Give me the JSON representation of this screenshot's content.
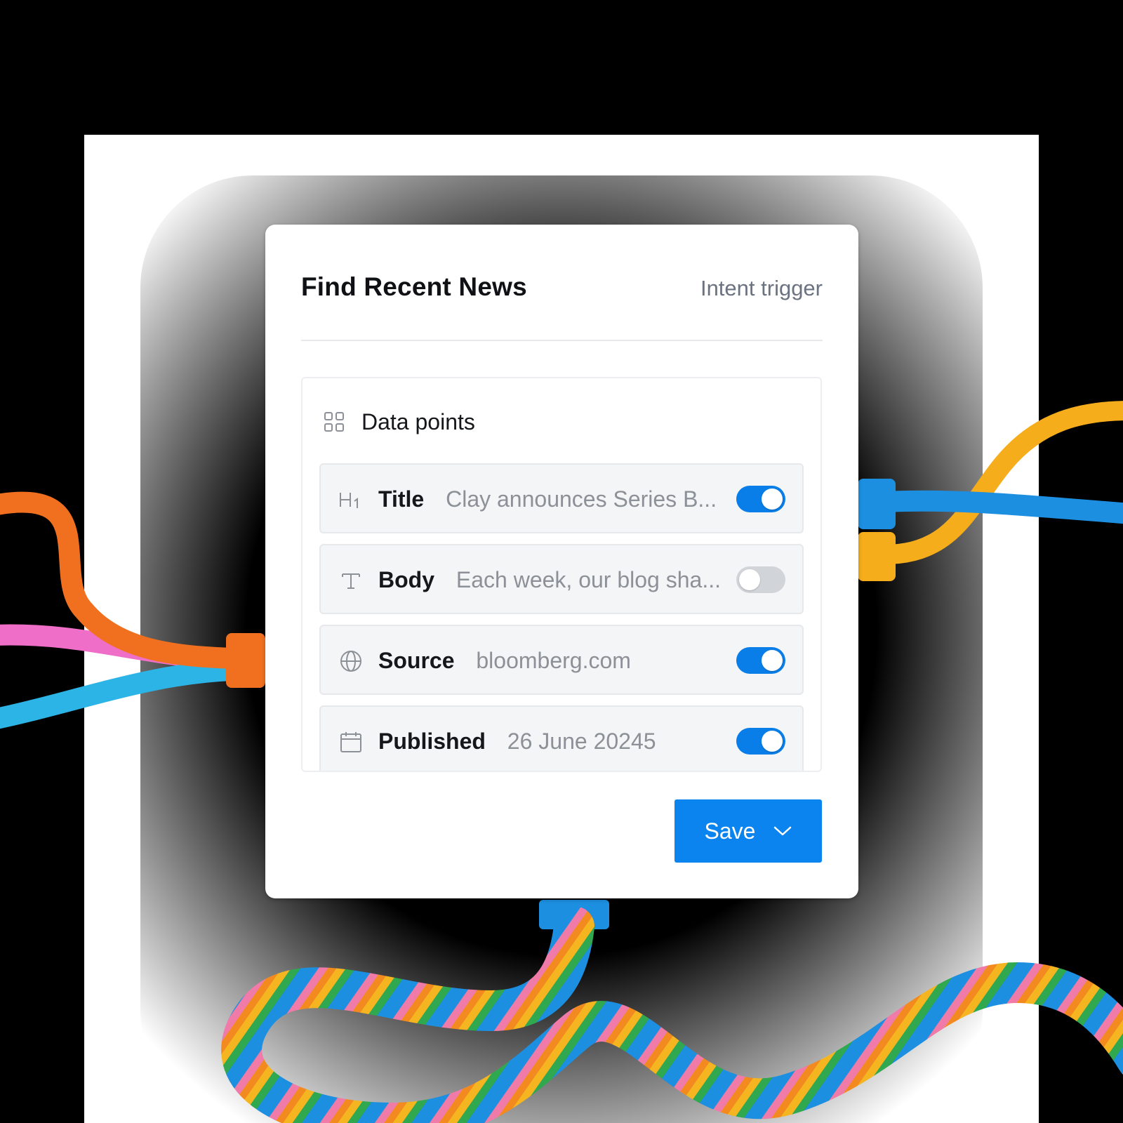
{
  "card": {
    "title": "Find Recent News",
    "subtitle": "Intent trigger"
  },
  "panel": {
    "header_icon": "grid-icon",
    "header_label": "Data points",
    "rows": [
      {
        "icon": "heading-icon",
        "label": "Title",
        "value": "Clay announces Series B...",
        "enabled": true
      },
      {
        "icon": "text-icon",
        "label": "Body",
        "value": "Each week, our blog sha...",
        "enabled": false
      },
      {
        "icon": "globe-icon",
        "label": "Source",
        "value": "bloomberg.com",
        "enabled": true
      },
      {
        "icon": "calendar-icon",
        "label": "Published",
        "value": "26 June 20245",
        "enabled": true
      }
    ]
  },
  "save_button": {
    "label": "Save",
    "icon": "chevron-down-icon"
  },
  "colors": {
    "accent": "#0b84f0",
    "toggle_on": "#0a7ee8",
    "toggle_off": "#d1d4d9"
  }
}
